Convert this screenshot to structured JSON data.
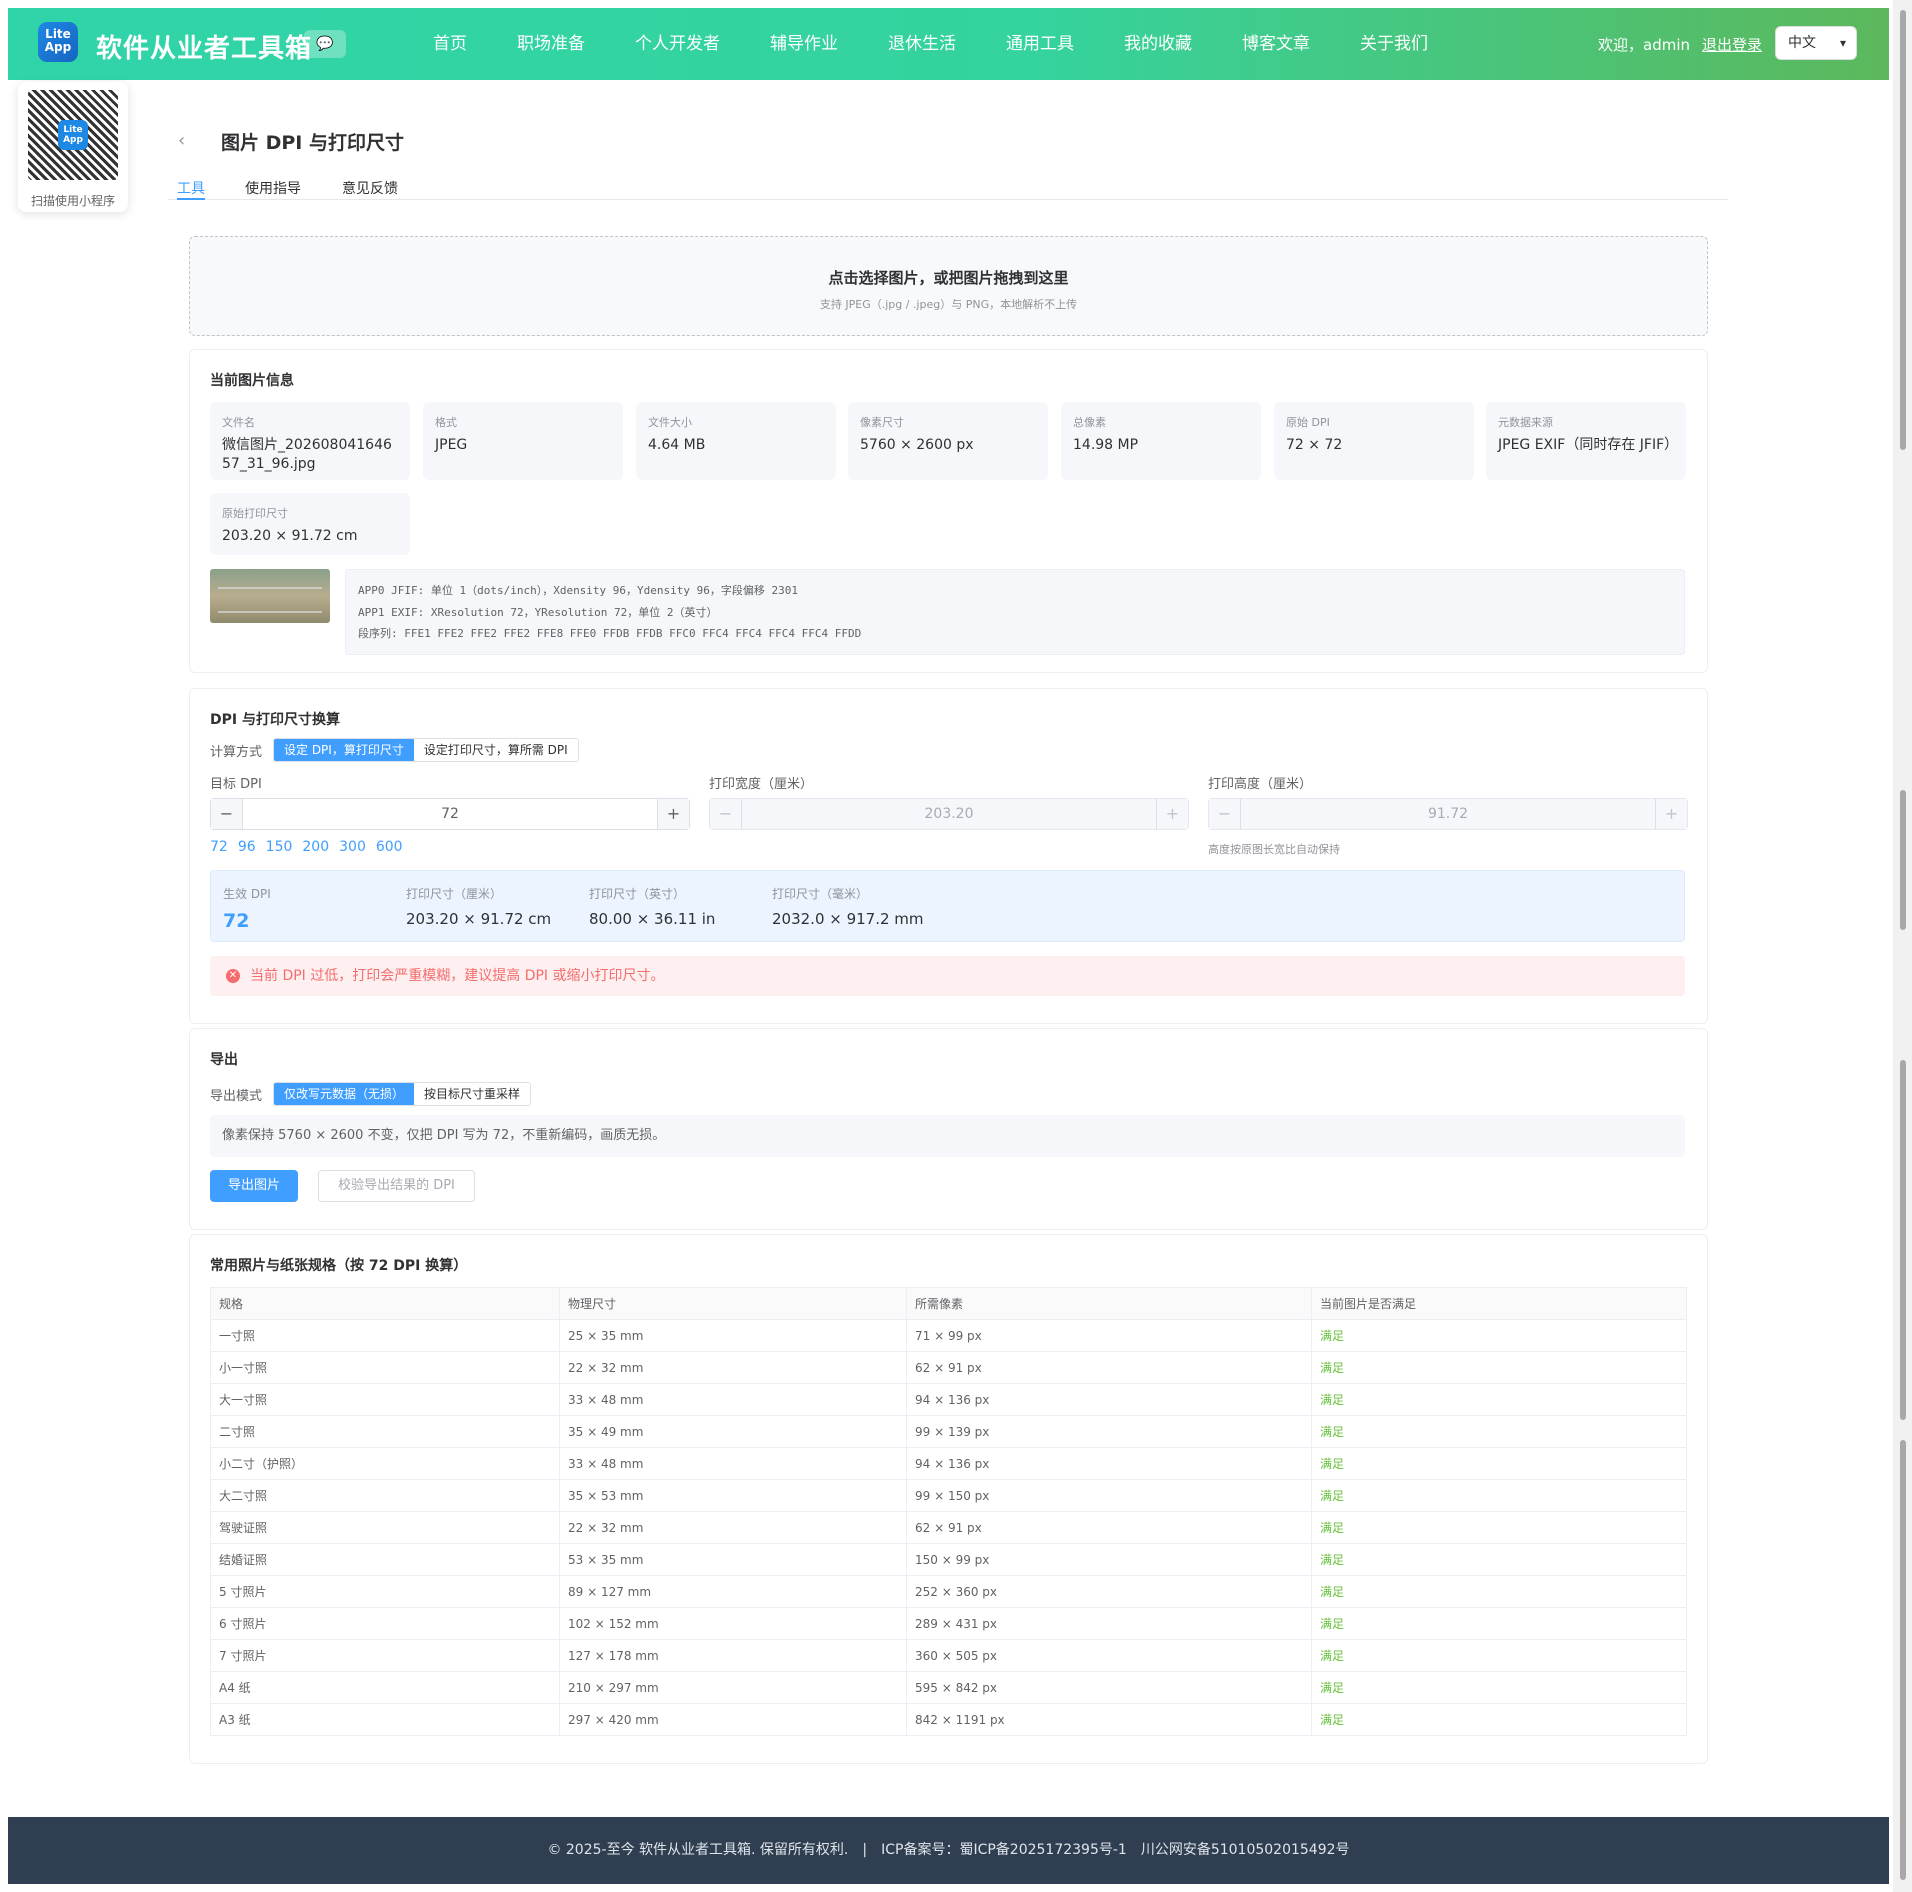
{
  "header": {
    "logo_text": "Lite App",
    "site_name": "软件从业者工具箱",
    "chat_icon": "💬",
    "nav": [
      "首页",
      "职场准备",
      "个人开发者",
      "辅导作业",
      "退休生活",
      "通用工具",
      "我的收藏",
      "博客文章",
      "关于我们"
    ],
    "welcome": "欢迎，admin",
    "logout": "退出登录",
    "language": "中文"
  },
  "qr": {
    "label": "扫描使用小程序",
    "inner": "Lite App"
  },
  "page": {
    "back_icon": "‹",
    "title": "图片 DPI 与打印尺寸",
    "tabs": [
      "工具",
      "使用指导",
      "意见反馈"
    ]
  },
  "upload": {
    "title": "点击选择图片，或把图片拖拽到这里",
    "subtitle": "支持 JPEG（.jpg / .jpeg）与 PNG，本地解析不上传"
  },
  "info": {
    "title": "当前图片信息",
    "cells": [
      {
        "k": "文件名",
        "v": "微信图片_20260804164657_31_96.jpg"
      },
      {
        "k": "格式",
        "v": "JPEG"
      },
      {
        "k": "文件大小",
        "v": "4.64 MB"
      },
      {
        "k": "像素尺寸",
        "v": "5760 × 2600 px"
      },
      {
        "k": "总像素",
        "v": "14.98 MP"
      },
      {
        "k": "原始 DPI",
        "v": "72 × 72"
      },
      {
        "k": "元数据来源",
        "v": "JPEG EXIF（同时存在 JFIF）"
      },
      {
        "k": "原始打印尺寸",
        "v": "203.20 × 91.72 cm"
      }
    ],
    "meta_lines": [
      "APP0 JFIF: 单位 1（dots/inch），Xdensity 96，Ydensity 96，字段偏移 2301",
      "APP1 EXIF: XResolution 72，YResolution 72，单位 2（英寸）",
      "段序列: FFE1 FFE2 FFE2 FFE2 FFE8 FFE0 FFDB FFDB FFC0 FFC4 FFC4 FFC4 FFC4 FFDD"
    ]
  },
  "calc": {
    "title": "DPI 与打印尺寸换算",
    "mode_label": "计算方式",
    "modes": [
      "设定 DPI，算打印尺寸",
      "设定打印尺寸，算所需 DPI"
    ],
    "dpi_label": "目标 DPI",
    "dpi_value": "72",
    "width_label": "打印宽度（厘米）",
    "width_value": "203.20",
    "height_label": "打印高度（厘米）",
    "height_value": "91.72",
    "presets": [
      "72",
      "96",
      "150",
      "200",
      "300",
      "600"
    ],
    "height_hint": "高度按原图长宽比自动保持",
    "results": [
      {
        "k": "生效 DPI",
        "v": "72"
      },
      {
        "k": "打印尺寸（厘米）",
        "v": "203.20 × 91.72 cm"
      },
      {
        "k": "打印尺寸（英寸）",
        "v": "80.00 × 36.11 in"
      },
      {
        "k": "打印尺寸（毫米）",
        "v": "2032.0 × 917.2 mm"
      }
    ],
    "alert_icon": "✕",
    "alert": "当前 DPI 过低，打印会严重模糊，建议提高 DPI 或缩小打印尺寸。"
  },
  "export": {
    "title": "导出",
    "mode_label": "导出模式",
    "modes": [
      "仅改写元数据（无损）",
      "按目标尺寸重采样"
    ],
    "desc": "像素保持 5760 × 2600 不变，仅把 DPI 写为 72，不重新编码，画质无损。",
    "export_btn": "导出图片",
    "verify_btn": "校验导出结果的 DPI"
  },
  "sizes": {
    "title": "常用照片与纸张规格（按 72 DPI 换算）",
    "headers": [
      "规格",
      "物理尺寸",
      "所需像素",
      "当前图片是否满足"
    ],
    "rows": [
      [
        "一寸照",
        "25 × 35 mm",
        "71 × 99 px",
        "满足"
      ],
      [
        "小一寸照",
        "22 × 32 mm",
        "62 × 91 px",
        "满足"
      ],
      [
        "大一寸照",
        "33 × 48 mm",
        "94 × 136 px",
        "满足"
      ],
      [
        "二寸照",
        "35 × 49 mm",
        "99 × 139 px",
        "满足"
      ],
      [
        "小二寸（护照）",
        "33 × 48 mm",
        "94 × 136 px",
        "满足"
      ],
      [
        "大二寸照",
        "35 × 53 mm",
        "99 × 150 px",
        "满足"
      ],
      [
        "驾驶证照",
        "22 × 32 mm",
        "62 × 91 px",
        "满足"
      ],
      [
        "结婚证照",
        "53 × 35 mm",
        "150 × 99 px",
        "满足"
      ],
      [
        "5 寸照片",
        "89 × 127 mm",
        "252 × 360 px",
        "满足"
      ],
      [
        "6 寸照片",
        "102 × 152 mm",
        "289 × 431 px",
        "满足"
      ],
      [
        "7 寸照片",
        "127 × 178 mm",
        "360 × 505 px",
        "满足"
      ],
      [
        "A4 纸",
        "210 × 297 mm",
        "595 × 842 px",
        "满足"
      ],
      [
        "A3 纸",
        "297 × 420 mm",
        "842 × 1191 px",
        "满足"
      ]
    ]
  },
  "footer": {
    "text": "© 2025-至今 软件从业者工具箱. 保留所有权利.　|　ICP备案号：蜀ICP备2025172395号-1　川公网安备51010502015492号"
  },
  "colors": {
    "accent": "#409eff",
    "success": "#67c23a",
    "danger": "#f56c6c",
    "header_from": "#2fd4a9",
    "header_to": "#5cb85c",
    "footer": "#2f3e50"
  }
}
